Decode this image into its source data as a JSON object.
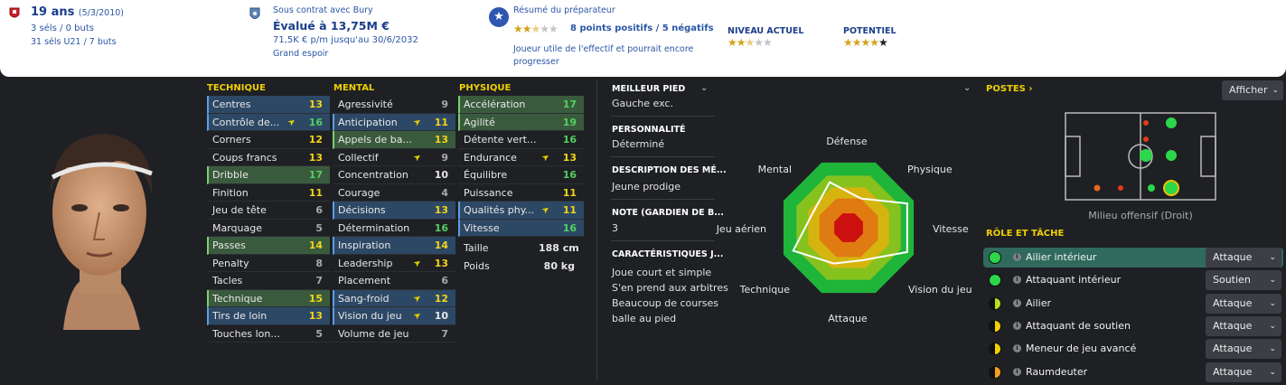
{
  "header": {
    "age": "19 ans",
    "dob": "(5/3/2010)",
    "caps": "3 séls / 0 buts",
    "u21": "31 séls U21 / 7 buts",
    "contract": "Sous contrat avec Bury",
    "value": "Évalué à 13,75M €",
    "wage": "71,5K € p/m jusqu'au 30/6/2032",
    "tag": "Grand espoir",
    "coach_title": "Résumé du préparateur",
    "coach_points": "8 points positifs / 5 négatifs",
    "coach_desc1": "Joueur utile de l'effectif et pourrait encore",
    "coach_desc2": "progresser",
    "coach_stars": 2.5,
    "current_label": "NIVEAU ACTUEL",
    "current_stars": 2.5,
    "potential_label": "POTENTIEL",
    "potential_stars": 4.5
  },
  "technique": {
    "title": "TECHNIQUE",
    "rows": [
      {
        "label": "Centres",
        "value": "13",
        "hl": "blue"
      },
      {
        "label": "Contrôle de...",
        "value": "16",
        "hl": "blue",
        "arrow": true
      },
      {
        "label": "Corners",
        "value": "12"
      },
      {
        "label": "Coups francs",
        "value": "13"
      },
      {
        "label": "Dribble",
        "value": "17",
        "hl": "green"
      },
      {
        "label": "Finition",
        "value": "11"
      },
      {
        "label": "Jeu de tête",
        "value": "6"
      },
      {
        "label": "Marquage",
        "value": "5"
      },
      {
        "label": "Passes",
        "value": "14",
        "hl": "green"
      },
      {
        "label": "Penalty",
        "value": "8"
      },
      {
        "label": "Tacles",
        "value": "7"
      },
      {
        "label": "Technique",
        "value": "15",
        "hl": "green"
      },
      {
        "label": "Tirs de loin",
        "value": "13",
        "hl": "blue"
      },
      {
        "label": "Touches lon...",
        "value": "5"
      }
    ]
  },
  "mental": {
    "title": "MENTAL",
    "rows": [
      {
        "label": "Agressivité",
        "value": "9"
      },
      {
        "label": "Anticipation",
        "value": "11",
        "hl": "blue",
        "arrow": true
      },
      {
        "label": "Appels de ba...",
        "value": "13",
        "hl": "green"
      },
      {
        "label": "Collectif",
        "value": "9",
        "arrow": true
      },
      {
        "label": "Concentration",
        "value": "10"
      },
      {
        "label": "Courage",
        "value": "4"
      },
      {
        "label": "Décisions",
        "value": "13",
        "hl": "blue"
      },
      {
        "label": "Détermination",
        "value": "16"
      },
      {
        "label": "Inspiration",
        "value": "14",
        "hl": "blue"
      },
      {
        "label": "Leadership",
        "value": "13",
        "arrow": true
      },
      {
        "label": "Placement",
        "value": "6"
      },
      {
        "label": "Sang-froid",
        "value": "12",
        "hl": "blue",
        "arrow": true
      },
      {
        "label": "Vision du jeu",
        "value": "10",
        "hl": "blue",
        "arrow": true
      },
      {
        "label": "Volume de jeu",
        "value": "7"
      }
    ]
  },
  "physique": {
    "title": "PHYSIQUE",
    "rows": [
      {
        "label": "Accélération",
        "value": "17",
        "hl": "green"
      },
      {
        "label": "Agilité",
        "value": "19",
        "hl": "green"
      },
      {
        "label": "Détente vert...",
        "value": "16"
      },
      {
        "label": "Endurance",
        "value": "13",
        "arrow": true
      },
      {
        "label": "Équilibre",
        "value": "16"
      },
      {
        "label": "Puissance",
        "value": "11"
      },
      {
        "label": "Qualités phy...",
        "value": "11",
        "hl": "blue",
        "arrow": true
      },
      {
        "label": "Vitesse",
        "value": "16",
        "hl": "blue"
      }
    ],
    "height_label": "Taille",
    "height": "188 cm",
    "weight_label": "Poids",
    "weight": "80 kg"
  },
  "info": {
    "foot_h": "MEILLEUR PIED",
    "foot": "Gauche exc.",
    "pers_h": "PERSONNALITÉ",
    "pers": "Déterminé",
    "desc_h": "DESCRIPTION DES MÉ...",
    "desc": "Jeune prodige",
    "gk_h": "NOTE (GARDIEN DE B...",
    "gk": "3",
    "traits_h": "CARACTÉRISTIQUES J...",
    "traits": [
      "Joue court et simple",
      "S'en prend aux arbitres",
      "Beaucoup de courses",
      "balle au pied"
    ]
  },
  "radar": {
    "labels": [
      "Défense",
      "Physique",
      "Vitesse",
      "Vision du jeu",
      "Attaque",
      "Technique",
      "Jeu aérien",
      "Mental"
    ],
    "values": [
      0.45,
      0.9,
      0.9,
      0.5,
      0.55,
      0.85,
      0.55,
      0.7
    ]
  },
  "positions": {
    "title": "POSTES",
    "show_button": "Afficher",
    "caption": "Milieu offensif (Droit)"
  },
  "roles": {
    "title": "RÔLE ET TÂCHE",
    "rows": [
      {
        "name": "Ailier intérieur",
        "duty": "Attaque",
        "icon": "full-green",
        "selected": true
      },
      {
        "name": "Attaquant intérieur",
        "duty": "Soutien",
        "icon": "full-green"
      },
      {
        "name": "Ailier",
        "duty": "Attaque",
        "icon": "half-lime"
      },
      {
        "name": "Attaquant de soutien",
        "duty": "Attaque",
        "icon": "half-yellow"
      },
      {
        "name": "Meneur de jeu avancé",
        "duty": "Attaque",
        "icon": "half-yellow"
      },
      {
        "name": "Raumdeuter",
        "duty": "Attaque",
        "icon": "half-orange"
      }
    ]
  },
  "colors": {
    "accent": "#f0d000",
    "high": "#53d05f",
    "mid": "#f2d41a",
    "low": "#a9a9a9",
    "panel_blue": "#2d4865",
    "panel_green": "#3a5a3d"
  }
}
